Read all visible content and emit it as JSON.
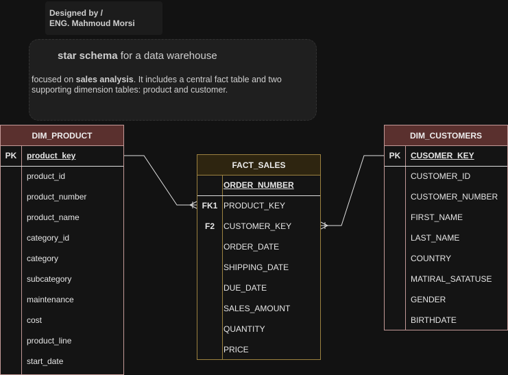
{
  "credit": {
    "line1": "Designed by /",
    "line2": "ENG. Mahmoud Morsi"
  },
  "note": {
    "title_bold": "star schema",
    "title_rest": " for a data warehouse",
    "body_pre": "focused on ",
    "body_bold": "sales analysis",
    "body_post": ". It includes a central fact table and two supporting dimension tables: product and customer."
  },
  "tables": {
    "dim_product": {
      "name": "DIM_PRODUCT",
      "pk_label": "PK",
      "fields": [
        "product_key",
        "product_id",
        "product_number",
        "product_name",
        "category_id",
        "category",
        "subcategory",
        "maintenance",
        "cost",
        "product_line",
        "start_date"
      ]
    },
    "fact_sales": {
      "name": "FACT_SALES",
      "keys": [
        "",
        "FK1",
        "F2",
        "",
        "",
        "",
        "",
        "",
        ""
      ],
      "fields": [
        "ORDER_NUMBER",
        "PRODUCT_KEY",
        "CUSTOMER_KEY",
        "ORDER_DATE",
        "SHIPPING_DATE",
        "DUE_DATE",
        "SALES_AMOUNT",
        "QUANTITY",
        "PRICE"
      ]
    },
    "dim_customers": {
      "name": "DIM_CUSTOMERS",
      "pk_label": "PK",
      "fields": [
        "CUSOMER_KEY",
        "CUSTOMER_ID",
        "CUSTOMER_NUMBER",
        "FIRST_NAME",
        "LAST_NAME",
        "COUNTRY",
        "MATIRAL_SATATUSE",
        "GENDER",
        "BIRTHDATE"
      ]
    }
  },
  "colors": {
    "dimension_header": "#5a302e",
    "dimension_border": "#c49a98",
    "fact_header": "#2e2510",
    "fact_border": "#9d8240",
    "connector": "#e0e0e0"
  }
}
